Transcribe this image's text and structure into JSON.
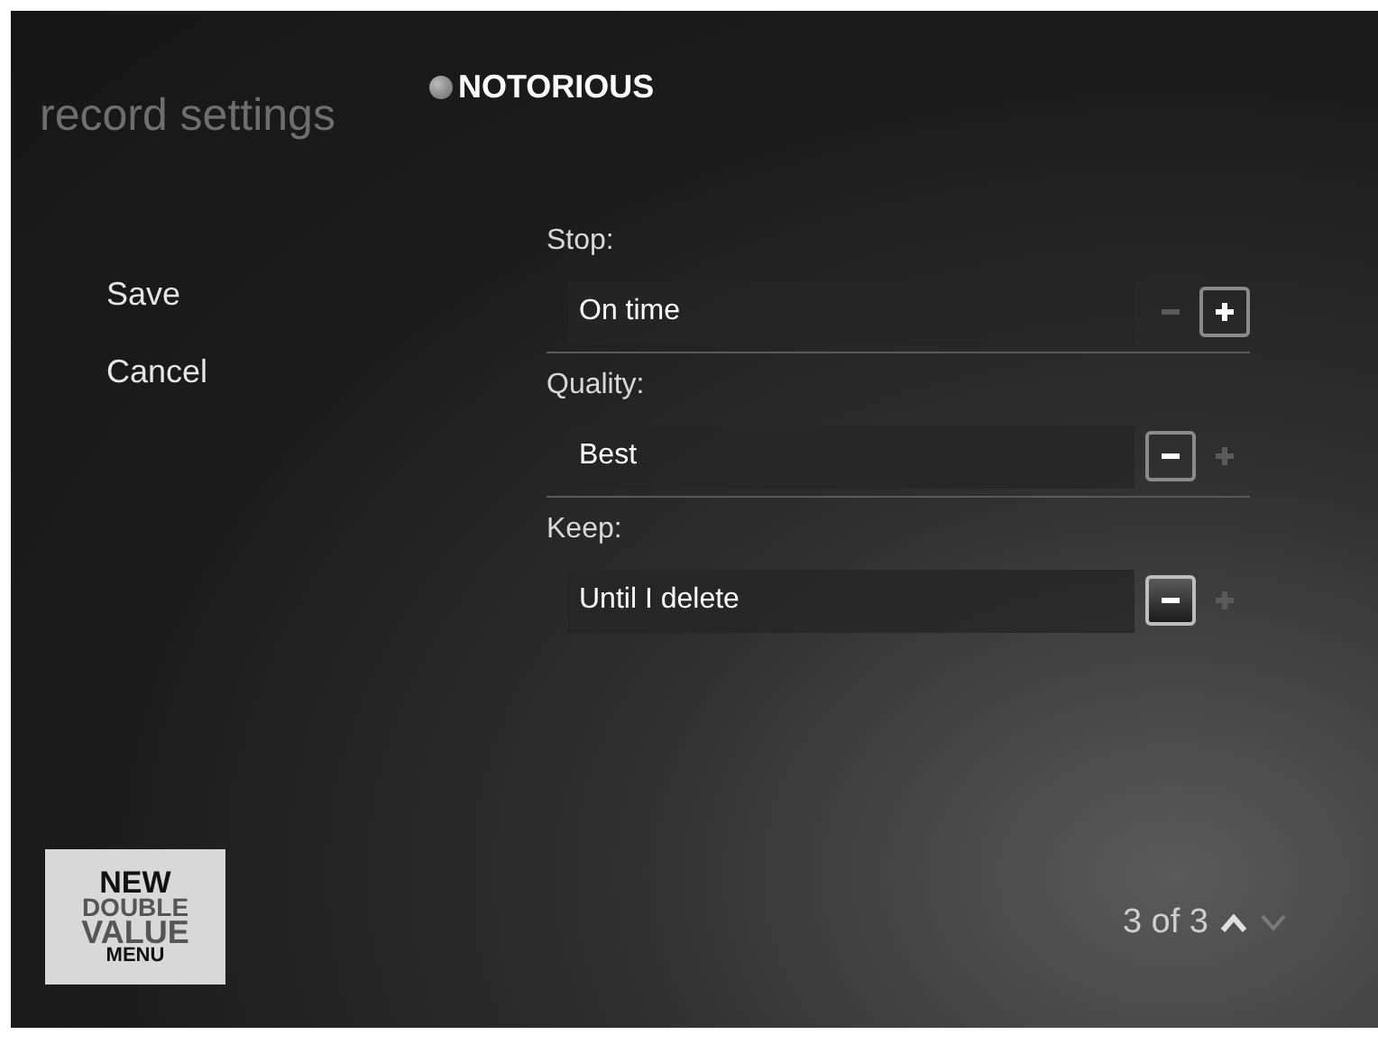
{
  "header": {
    "title": "record settings",
    "program": "NOTORIOUS"
  },
  "actions": [
    {
      "label": "Save"
    },
    {
      "label": "Cancel"
    }
  ],
  "settings": [
    {
      "label": "Stop:",
      "value": "On time",
      "minus": {
        "enabled": false,
        "focused": false
      },
      "plus": {
        "enabled": true,
        "focused": false
      }
    },
    {
      "label": "Quality:",
      "value": "Best",
      "minus": {
        "enabled": true,
        "focused": false
      },
      "plus": {
        "enabled": false,
        "focused": false
      }
    },
    {
      "label": "Keep:",
      "value": "Until I delete",
      "minus": {
        "enabled": true,
        "focused": true
      },
      "plus": {
        "enabled": false,
        "focused": false
      }
    }
  ],
  "promo": {
    "lines": [
      "NEW",
      "DOUBLE",
      "VALUE",
      "MENU"
    ]
  },
  "pager": {
    "text": "3 of 3",
    "up_enabled": true,
    "down_enabled": false
  }
}
